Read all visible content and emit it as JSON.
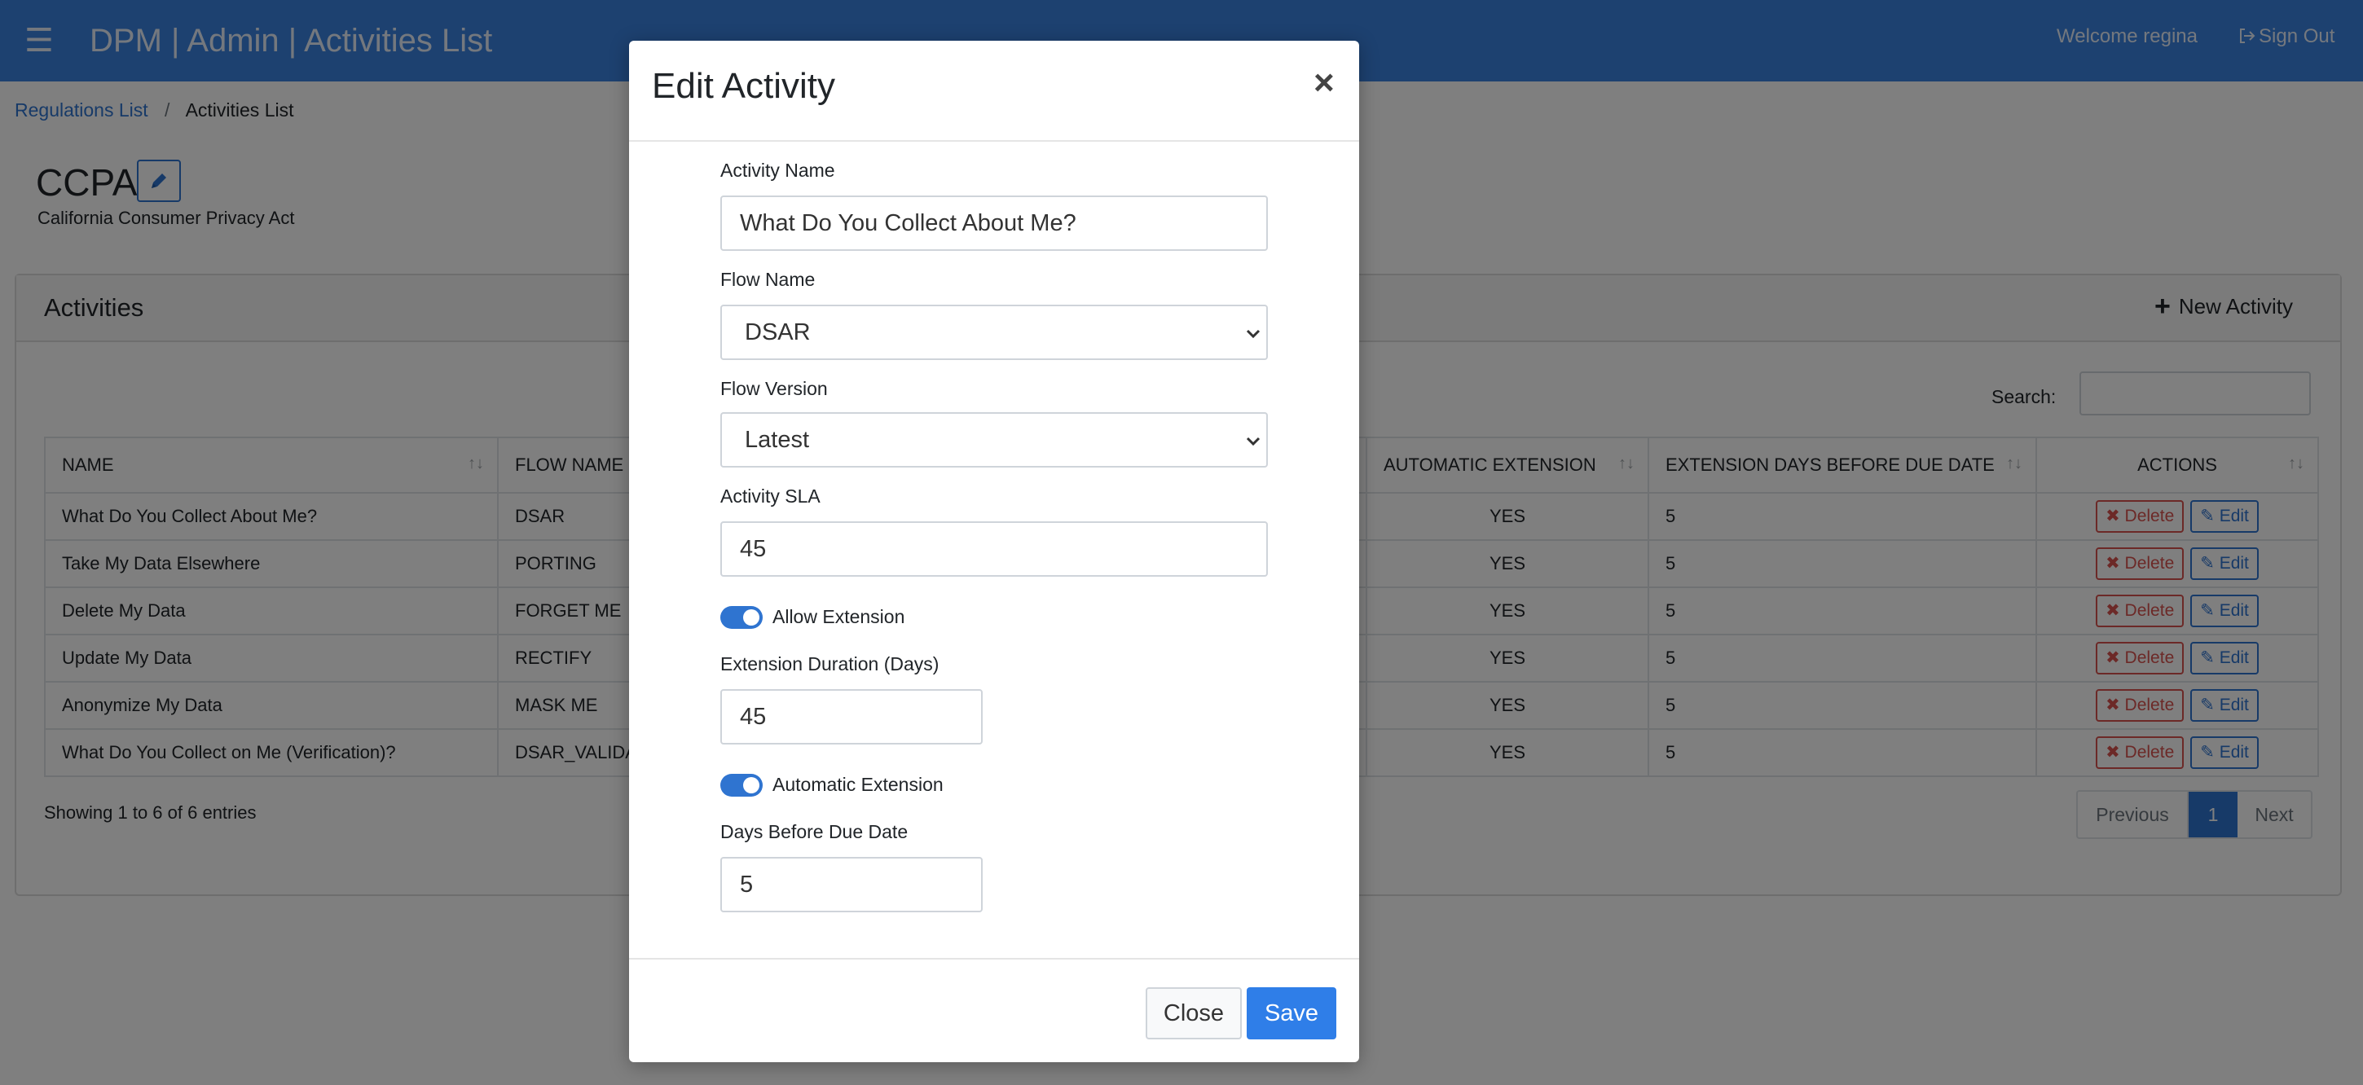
{
  "header": {
    "title": "DPM | Admin | Activities List",
    "welcome": "Welcome regina",
    "signout": "Sign Out"
  },
  "breadcrumb": {
    "items": [
      "Regulations List",
      "Activities List"
    ],
    "separator": "/"
  },
  "regulation": {
    "title": "CCPA",
    "subtitle": "California Consumer Privacy Act"
  },
  "card": {
    "title": "Activities",
    "new_activity_label": "New Activity",
    "search_label": "Search:",
    "search_value": ""
  },
  "table": {
    "columns": [
      "NAME",
      "FLOW NAME",
      "AUTOMATIC EXTENSION",
      "EXTENSION DAYS BEFORE DUE DATE",
      "ACTIONS"
    ],
    "rows": [
      {
        "name": "What Do You Collect About Me?",
        "flow": "DSAR",
        "auto": "YES",
        "days": "5"
      },
      {
        "name": "Take My Data Elsewhere",
        "flow": "PORTING",
        "auto": "YES",
        "days": "5"
      },
      {
        "name": "Delete My Data",
        "flow": "FORGET ME",
        "auto": "YES",
        "days": "5"
      },
      {
        "name": "Update My Data",
        "flow": "RECTIFY",
        "auto": "YES",
        "days": "5"
      },
      {
        "name": "Anonymize My Data",
        "flow": "MASK ME",
        "auto": "YES",
        "days": "5"
      },
      {
        "name": "What Do You Collect on Me (Verification)?",
        "flow": "DSAR_VALIDA",
        "auto": "YES",
        "days": "5"
      }
    ],
    "delete_label": "Delete",
    "edit_label": "Edit",
    "showing": "Showing 1 to 6 of 6 entries",
    "pager": {
      "previous": "Previous",
      "current": "1",
      "next": "Next"
    }
  },
  "modal": {
    "title": "Edit Activity",
    "activity_name_label": "Activity Name",
    "activity_name_value": "What Do You Collect About Me?",
    "flow_name_label": "Flow Name",
    "flow_name_value": "DSAR",
    "flow_version_label": "Flow Version",
    "flow_version_value": "Latest",
    "sla_label": "Activity SLA",
    "sla_value": "45",
    "allow_extension_label": "Allow Extension",
    "allow_extension_on": true,
    "extension_duration_label": "Extension Duration (Days)",
    "extension_duration_value": "45",
    "automatic_extension_label": "Automatic Extension",
    "automatic_extension_on": true,
    "days_before_due_label": "Days Before Due Date",
    "days_before_due_value": "5",
    "close_label": "Close",
    "save_label": "Save"
  },
  "colors": {
    "topbar": "#3b82e0",
    "primary": "#2f74d0",
    "danger": "#d9534f",
    "save": "#2f7ee8"
  }
}
